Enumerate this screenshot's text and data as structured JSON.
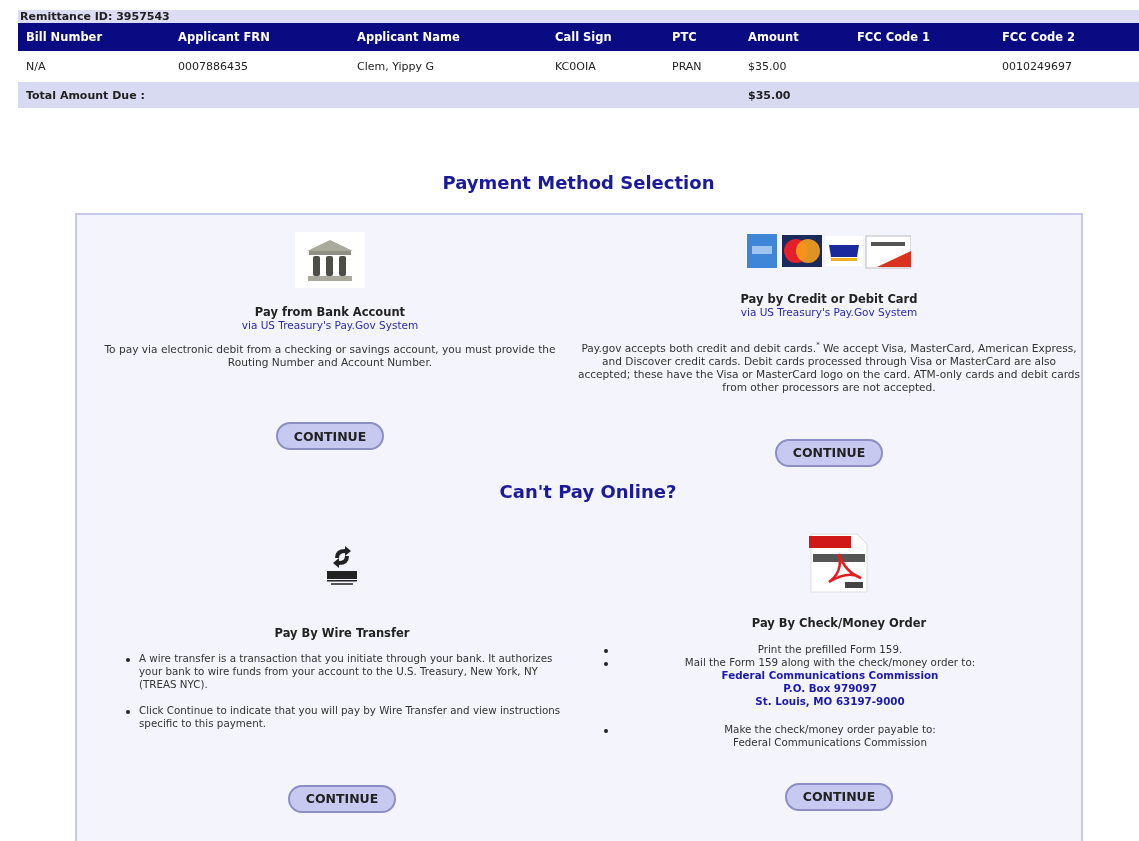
{
  "remittance_id": "Remittance ID: 3957543",
  "bill_table": {
    "columns": [
      "Bill Number",
      "Applicant FRN",
      "Applicant Name",
      "Call Sign",
      "PTC",
      "Amount",
      "FCC Code 1",
      "FCC Code 2"
    ],
    "rows": [
      [
        "N/A",
        "0007886435",
        "Clem, Yippy G",
        "KC0OIA",
        "PRAN",
        "$35.00",
        "",
        "0010249697"
      ]
    ],
    "total": {
      "label": "Total Amount Due :",
      "amount": "$35.00"
    }
  },
  "payment": {
    "title": "Payment Method Selection",
    "online": [
      {
        "kind": "bank",
        "title": "Pay from Bank Account",
        "subtitle": "via US Treasury's Pay.Gov System",
        "description": "To pay via electronic debit from a checking or savings account, you must provide the Routing Number and Account Number.",
        "button": "CONTINUE"
      },
      {
        "kind": "card",
        "title": "Pay by Credit or Debit Card",
        "subtitle": "via US Treasury's Pay.Gov System",
        "description": "Pay.gov accepts both credit and debit cards.$^{*}$ We accept Visa, MasterCard, American Express, and Discover credit cards. Debit cards processed through Visa or MasterCard are also accepted; these have the Visa or MasterCard logo on the card. ATM-only cards and debit cards from other processors are not accepted.",
        "button": "CONTINUE"
      }
    ],
    "offline_title": "Can't Pay Online?",
    "offline": [
      {
        "kind": "wire",
        "title": "Pay By Wire Transfer",
        "items": [
          {
            "lines": [
              {
                "text": "A wire transfer is a transaction that you initiate through your bank. It authorizes your bank to wire funds from your account to the U.S. Treasury, New York, NY (TREAS NYC).",
                "highlight": false
              }
            ]
          },
          {
            "lines": [
              {
                "text": "Click Continue to indicate that you will pay by Wire Transfer and view instructions specific to this payment.",
                "highlight": false
              }
            ]
          }
        ],
        "button": "CONTINUE"
      },
      {
        "kind": "check",
        "title": "Pay By Check/Money Order",
        "items": [
          {
            "lines": [
              {
                "text": "Print the prefilled Form 159.",
                "highlight": false
              }
            ]
          },
          {
            "lines": [
              {
                "text": "Mail the Form 159 along with the check/money order to:",
                "highlight": false
              },
              {
                "text": "Federal Communications Commission",
                "highlight": true
              },
              {
                "text": "P.O. Box 979097",
                "highlight": true
              },
              {
                "text": "St. Louis, MO 63197-9000",
                "highlight": true
              }
            ]
          },
          {
            "lines": [
              {
                "text": "Make the check/money order payable to:",
                "highlight": false
              },
              {
                "text": "Federal Communications Commission",
                "highlight": false
              }
            ]
          }
        ],
        "button": "CONTINUE"
      }
    ]
  }
}
